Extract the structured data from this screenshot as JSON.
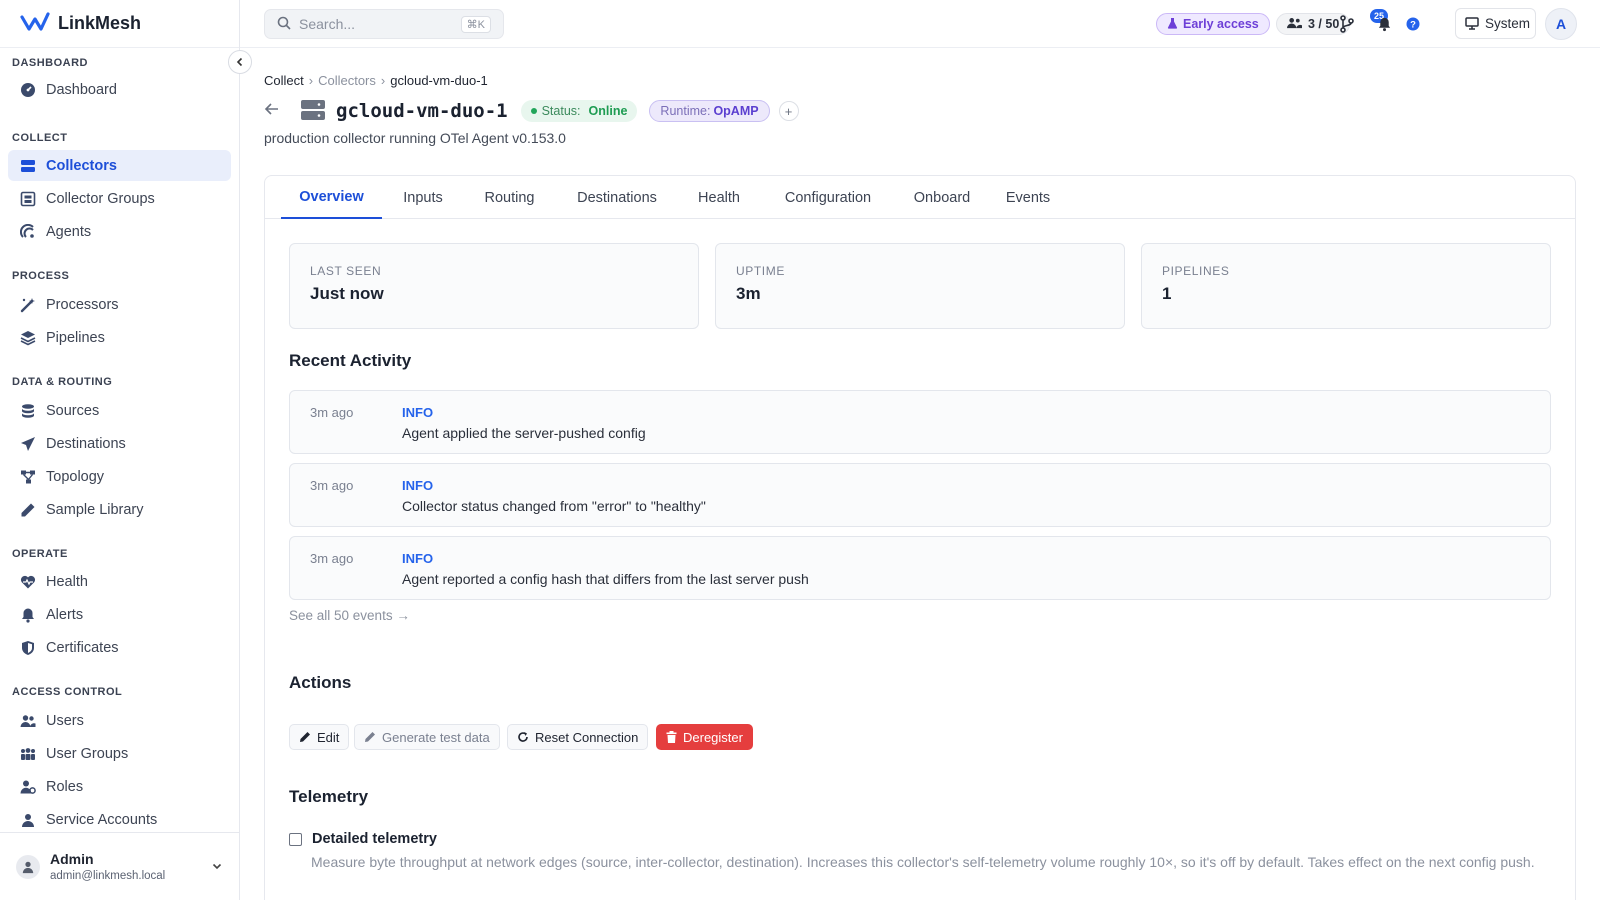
{
  "app": {
    "name": "LinkMesh",
    "accent_color": "#1d4fd8"
  },
  "sidebar": {
    "sections": [
      {
        "title": "DASHBOARD",
        "items": [
          {
            "label": "Dashboard",
            "icon": "dashboard-icon"
          }
        ]
      },
      {
        "title": "COLLECT",
        "items": [
          {
            "label": "Collectors",
            "icon": "collectors-icon",
            "active": true
          },
          {
            "label": "Collector Groups",
            "icon": "collector-groups-icon"
          },
          {
            "label": "Agents",
            "icon": "agents-icon"
          }
        ]
      },
      {
        "title": "PROCESS",
        "items": [
          {
            "label": "Processors",
            "icon": "processors-icon"
          },
          {
            "label": "Pipelines",
            "icon": "pipelines-icon"
          }
        ]
      },
      {
        "title": "DATA & ROUTING",
        "items": [
          {
            "label": "Sources",
            "icon": "sources-icon"
          },
          {
            "label": "Destinations",
            "icon": "destinations-icon"
          },
          {
            "label": "Topology",
            "icon": "topology-icon"
          },
          {
            "label": "Sample Library",
            "icon": "sample-library-icon"
          }
        ]
      },
      {
        "title": "OPERATE",
        "items": [
          {
            "label": "Health",
            "icon": "health-icon"
          },
          {
            "label": "Alerts",
            "icon": "alerts-icon"
          },
          {
            "label": "Certificates",
            "icon": "certificates-icon"
          }
        ]
      },
      {
        "title": "ACCESS CONTROL",
        "items": [
          {
            "label": "Users",
            "icon": "users-icon"
          },
          {
            "label": "User Groups",
            "icon": "user-groups-icon"
          },
          {
            "label": "Roles",
            "icon": "roles-icon"
          },
          {
            "label": "Service Accounts",
            "icon": "service-accounts-icon"
          }
        ]
      }
    ],
    "user": {
      "name": "Admin",
      "email": "admin@linkmesh.local"
    }
  },
  "topbar": {
    "search_placeholder": "Search...",
    "search_shortcut": "⌘K",
    "early_access": "Early access",
    "seats": "3 / 50",
    "notifications_count": "25",
    "theme": "System",
    "avatar_initial": "A"
  },
  "breadcrumb": [
    "Collect",
    "Collectors",
    "gcloud-vm-duo-1"
  ],
  "header": {
    "title": "gcloud-vm-duo-1",
    "status_label": "Status:",
    "status_value": "Online",
    "runtime_label": "Runtime:",
    "runtime_value": "OpAMP",
    "add_symbol": "+",
    "description": "production collector running OTel Agent v0.153.0"
  },
  "tabs": [
    "Overview",
    "Inputs",
    "Routing",
    "Destinations",
    "Health",
    "Configuration",
    "Onboard",
    "Events"
  ],
  "active_tab": "Overview",
  "stats": [
    {
      "label": "LAST SEEN",
      "value": "Just now"
    },
    {
      "label": "UPTIME",
      "value": "3m"
    },
    {
      "label": "PIPELINES",
      "value": "1"
    }
  ],
  "recent_activity": {
    "title": "Recent Activity",
    "items": [
      {
        "time": "3m ago",
        "level": "INFO",
        "message": "Agent applied the server-pushed config"
      },
      {
        "time": "3m ago",
        "level": "INFO",
        "message": "Collector status changed from \"error\" to \"healthy\""
      },
      {
        "time": "3m ago",
        "level": "INFO",
        "message": "Agent reported a config hash that differs from the last server push"
      }
    ],
    "see_all": "See all 50 events →"
  },
  "actions": {
    "title": "Actions",
    "edit": "Edit",
    "generate": "Generate test data",
    "reset": "Reset Connection",
    "deregister": "Deregister"
  },
  "telemetry": {
    "title": "Telemetry",
    "checkbox_label": "Detailed telemetry",
    "checked": false,
    "description": "Measure byte throughput at network edges (source, inter-collector, destination). Increases this collector's self-telemetry volume roughly 10×, so it's off by default. Takes effect on the next config push."
  }
}
